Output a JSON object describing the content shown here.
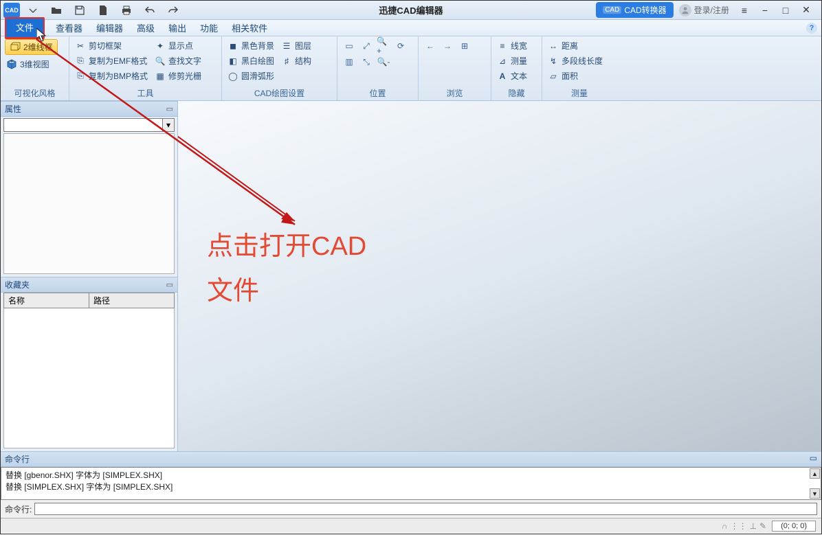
{
  "title": "迅捷CAD编辑器",
  "quick_access": {
    "app_icon_text": "CAD"
  },
  "title_right": {
    "converter_badge": "CAD",
    "converter": "CAD转换器",
    "login": "登录/注册"
  },
  "window_controls": {
    "menu": "≡",
    "min": "−",
    "max": "□",
    "close": "✕"
  },
  "menu": {
    "file": "文件",
    "viewer": "查看器",
    "editor": "编辑器",
    "advanced": "高级",
    "output": "输出",
    "function": "功能",
    "related": "相关软件",
    "help": "?"
  },
  "ribbon": {
    "visual_style": {
      "wire2d": "2维线框",
      "view3d": "3维视图",
      "label": "可视化风格"
    },
    "tools": {
      "crop_frame": "剪切框架",
      "copy_emf": "复制为EMF格式",
      "copy_bmp": "复制为BMP格式",
      "show_point": "显示点",
      "find_text": "查找文字",
      "trim_grid": "修剪光栅",
      "label": "工具"
    },
    "cad_setting": {
      "black_bg": "黑色背景",
      "bw_draw": "黑白绘图",
      "smooth_arc": "圆滑弧形",
      "layers": "图层",
      "struct": "结构",
      "label": "CAD绘图设置"
    },
    "position": {
      "label": "位置"
    },
    "browse": {
      "label": "浏览"
    },
    "hide": {
      "line_width": "线宽",
      "measure": "测量",
      "text": "文本",
      "label": "隐藏"
    },
    "measure": {
      "distance": "距离",
      "polyline_len": "多段线长度",
      "area": "面积",
      "label": "测量"
    }
  },
  "panels": {
    "properties": {
      "title": "属性",
      "pin": "▭"
    },
    "favorites": {
      "title": "收藏夹",
      "col_name": "名称",
      "col_path": "路径",
      "pin": "▭"
    }
  },
  "annotation": {
    "line1": "点击打开CAD",
    "line2": "文件"
  },
  "command": {
    "title": "命令行",
    "pin": "▭",
    "log1": "替换 [gbenor.SHX] 字体为 [SIMPLEX.SHX]",
    "log2": "替换 [SIMPLEX.SHX] 字体为 [SIMPLEX.SHX]",
    "prompt": "命令行:"
  },
  "status": {
    "coord": "(0; 0; 0)"
  }
}
